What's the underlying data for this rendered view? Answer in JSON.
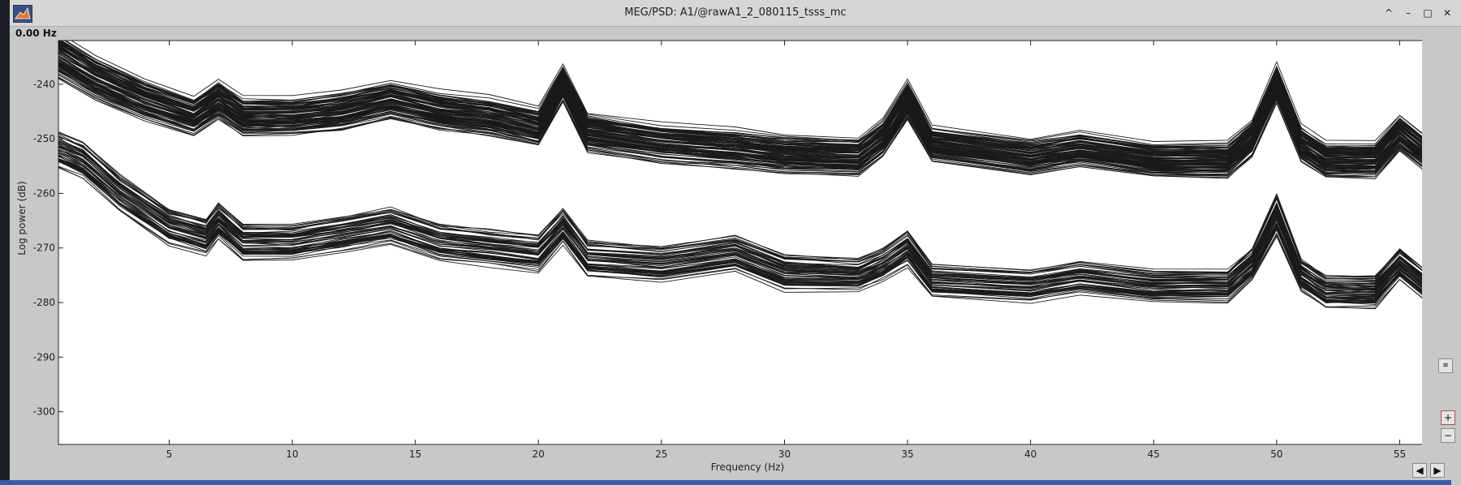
{
  "window": {
    "title": "MEG/PSD: A1/@rawA1_2_080115_tsss_mc",
    "controls": [
      "minimize-up",
      "minimize",
      "maximize",
      "close"
    ]
  },
  "readout": {
    "frequency": "0.00 Hz"
  },
  "buttons": {
    "zoom_in": "+",
    "zoom_out": "−",
    "scroll_left": "◀",
    "scroll_right": "▶",
    "legend": "≋"
  },
  "chart_data": {
    "type": "line",
    "title": "",
    "xlabel": "Frequency (Hz)",
    "ylabel": "Log power   (dB)",
    "xlim": [
      0.5,
      56.5
    ],
    "ylim": [
      -306,
      -232
    ],
    "x_ticks": [
      5,
      10,
      15,
      20,
      25,
      30,
      35,
      40,
      45,
      50,
      55
    ],
    "y_ticks": [
      -240,
      -250,
      -260,
      -270,
      -280,
      -290,
      -300
    ],
    "line_color": "#1a1a1a",
    "groups": [
      {
        "name": "",
        "count": 100,
        "x": [
          0.5,
          2,
          4,
          6,
          7,
          8,
          10,
          12,
          14,
          16,
          18,
          20,
          21,
          22,
          25,
          28,
          30,
          33,
          34,
          35,
          36,
          40,
          42,
          45,
          48,
          49,
          50,
          51,
          52,
          54,
          55,
          56.5
        ],
        "center": [
          -235,
          -239,
          -243,
          -246,
          -243,
          -246,
          -246,
          -245,
          -243,
          -245,
          -246,
          -248,
          -240,
          -249,
          -251,
          -252,
          -253,
          -253.5,
          -250,
          -243,
          -251,
          -253.5,
          -252,
          -254,
          -254,
          -250,
          -240,
          -251,
          -254,
          -254,
          -249,
          -254.5
        ],
        "spread": [
          7,
          7,
          6.5,
          6,
          6,
          6,
          6,
          6,
          6,
          6,
          6,
          6,
          6,
          6,
          6,
          6,
          6,
          6,
          6,
          6,
          5.5,
          5.5,
          5.5,
          5.5,
          5.5,
          5.5,
          6,
          5.5,
          5.5,
          5.5,
          5.5,
          5.5
        ]
      },
      {
        "name": "",
        "count": 60,
        "x": [
          0.5,
          1.5,
          3,
          5,
          6.5,
          7,
          8,
          10,
          12,
          14,
          16,
          18,
          20,
          21,
          22,
          25,
          28,
          30,
          33,
          34,
          35,
          36,
          40,
          42,
          45,
          48,
          49,
          50,
          51,
          52,
          54,
          55,
          56.5
        ],
        "center": [
          -252,
          -254,
          -260,
          -266,
          -268,
          -265,
          -269,
          -269,
          -267.5,
          -266,
          -269,
          -270,
          -271,
          -266,
          -272,
          -273,
          -271,
          -274.5,
          -275,
          -273,
          -270,
          -276,
          -277,
          -275.5,
          -277,
          -277,
          -273,
          -264,
          -275,
          -278,
          -278,
          -273,
          -278.5
        ],
        "spread": [
          5,
          5,
          5,
          5,
          5,
          5,
          5,
          5,
          5,
          5,
          5,
          5,
          5,
          5,
          5,
          5,
          5,
          5,
          4.5,
          4.5,
          5,
          4.5,
          4.5,
          4.5,
          4.5,
          4.5,
          4.5,
          6,
          4.5,
          4.5,
          4.5,
          4.5,
          4.5
        ]
      }
    ]
  }
}
